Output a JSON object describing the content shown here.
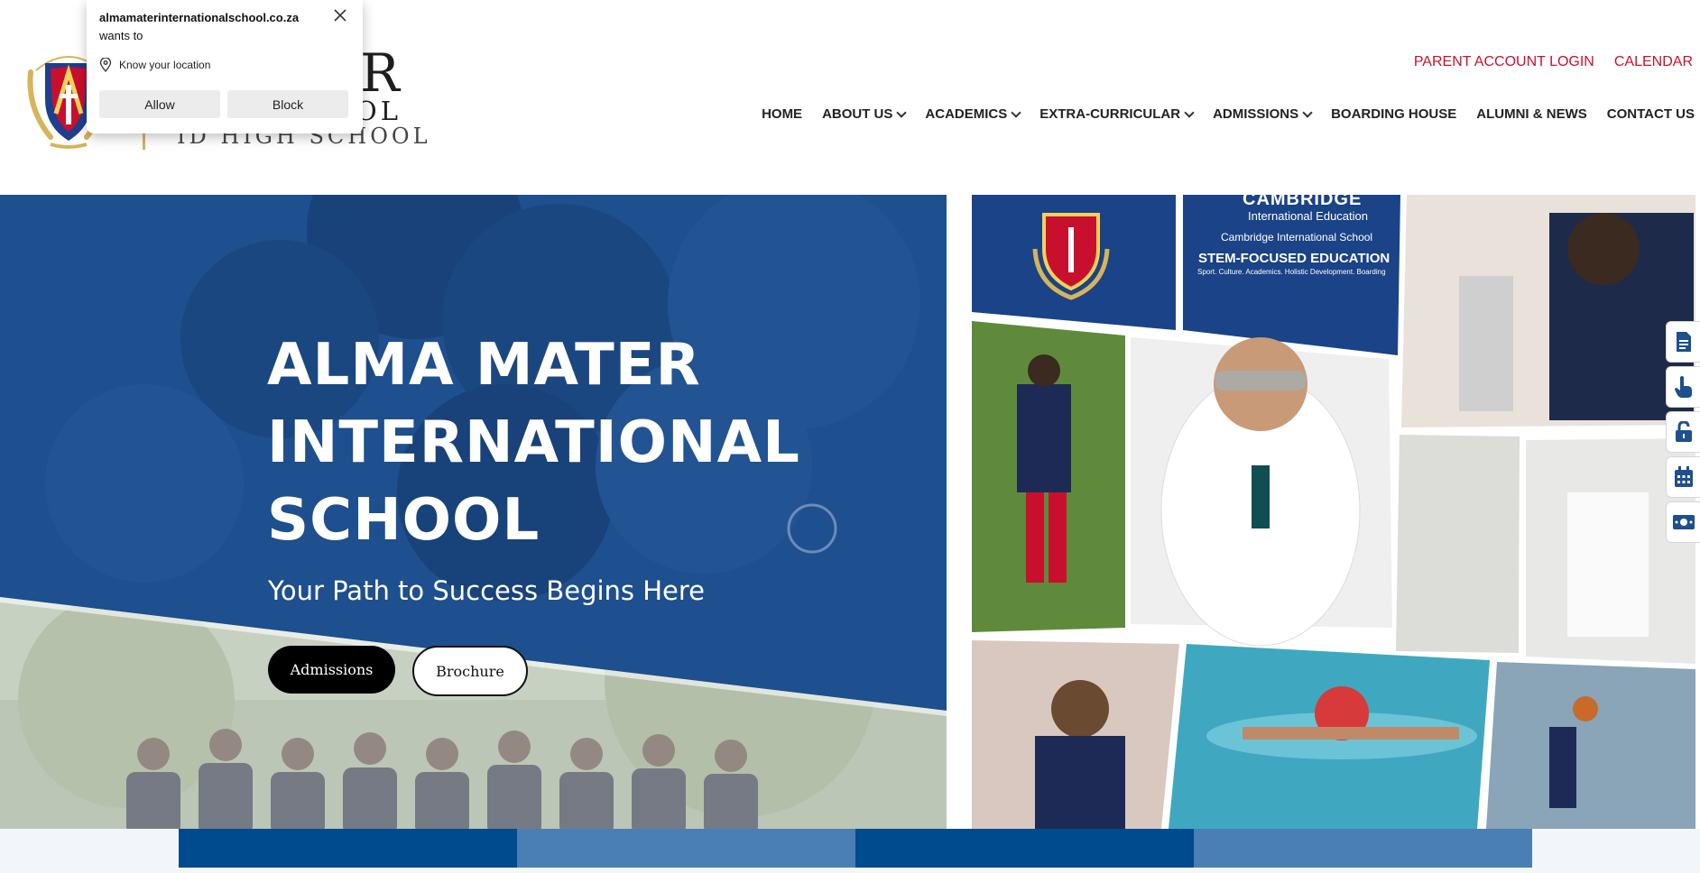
{
  "permission_prompt": {
    "site": "almamaterinternationalschool.co.za",
    "wants_to": "wants to",
    "permission": "Know your location",
    "allow_label": "Allow",
    "block_label": "Block"
  },
  "logo": {
    "line1": "MATER",
    "line2": "NAL SCHOOL",
    "line3": "ID HIGH SCHOOL"
  },
  "top_links": {
    "parent_login": "PARENT ACCOUNT LOGIN",
    "calendar": "CALENDAR"
  },
  "nav": {
    "home": "HOME",
    "about": "ABOUT US",
    "academics": "ACADEMICS",
    "extra": "EXTRA-CURRICULAR",
    "admissions": "ADMISSIONS",
    "boarding": "BOARDING HOUSE",
    "alumni": "ALUMNI & NEWS",
    "contact": "CONTACT US"
  },
  "hero": {
    "title_line1": "ALMA MATER",
    "title_line2": "INTERNATIONAL",
    "title_line3": "SCHOOL",
    "subtitle": "Your Path to Success Begins Here",
    "admissions_label": "Admissions",
    "brochure_label": "Brochure"
  },
  "collage": {
    "cambridge": "CAMBRIDGE",
    "intl_education": "International Education",
    "cambridge_school": "Cambridge International School",
    "stem": "STEM-FOCUSED EDUCATION",
    "pillars": "Sport. Culture. Academics. Holistic Development. Boarding"
  },
  "colors": {
    "accent_red": "#c8102e",
    "brand_blue": "#1e4f8e",
    "dark_blue": "#004b8d",
    "mid_blue": "#4a7fb5"
  },
  "side_toolbar_icons": [
    "document-icon",
    "pointer-hand-icon",
    "unlock-icon",
    "calendar-icon",
    "money-icon"
  ]
}
